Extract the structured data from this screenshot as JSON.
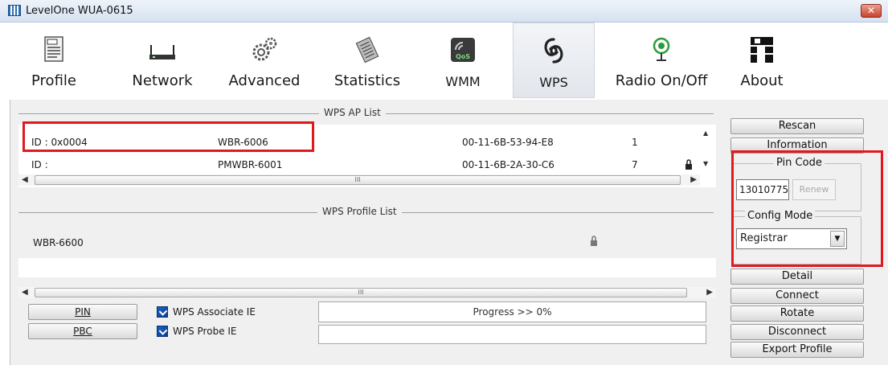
{
  "window": {
    "title": "LevelOne WUA-0615",
    "close_label": "✕"
  },
  "toolbar": {
    "items": [
      {
        "label": "Profile",
        "icon": "profile-icon"
      },
      {
        "label": "Network",
        "icon": "network-icon"
      },
      {
        "label": "Advanced",
        "icon": "gear-icon"
      },
      {
        "label": "Statistics",
        "icon": "statistics-icon"
      },
      {
        "label": "WMM",
        "icon": "qos-icon",
        "icon_text": "QoS"
      },
      {
        "label": "WPS",
        "icon": "wps-icon",
        "active": true
      },
      {
        "label": "Radio On/Off",
        "icon": "radio-icon"
      },
      {
        "label": "About",
        "icon": "about-icon"
      }
    ]
  },
  "ap_list": {
    "title": "WPS AP List",
    "rows": [
      {
        "id": "ID : 0x0004",
        "ssid": "WBR-6006",
        "mac": "00-11-6B-53-94-E8",
        "channel": "1"
      },
      {
        "id": "ID :",
        "ssid": "PMWBR-6001",
        "mac": "00-11-6B-2A-30-C6",
        "channel": "7"
      }
    ],
    "scroll_thumb": "III"
  },
  "profile_list": {
    "title": "WPS Profile List",
    "rows": [
      {
        "name": "WBR-6600"
      }
    ],
    "scroll_thumb": "III"
  },
  "side": {
    "rescan": "Rescan",
    "information": "Information",
    "pin_code_label": "Pin Code",
    "pin_code_value": "13010775",
    "renew": "Renew",
    "config_mode_label": "Config Mode",
    "config_mode_value": "Registrar",
    "detail": "Detail",
    "connect": "Connect",
    "rotate": "Rotate",
    "disconnect": "Disconnect",
    "export_profile": "Export Profile"
  },
  "bottom": {
    "pin_button": "PIN",
    "pbc_button": "PBC",
    "associate_ie": "WPS Associate IE",
    "probe_ie": "WPS Probe IE",
    "associate_checked": true,
    "probe_checked": true,
    "progress_text": "Progress >> 0%",
    "progress_percent": 0
  },
  "colors": {
    "highlight_box": "#e0191f",
    "accent": "#1a62c4"
  }
}
